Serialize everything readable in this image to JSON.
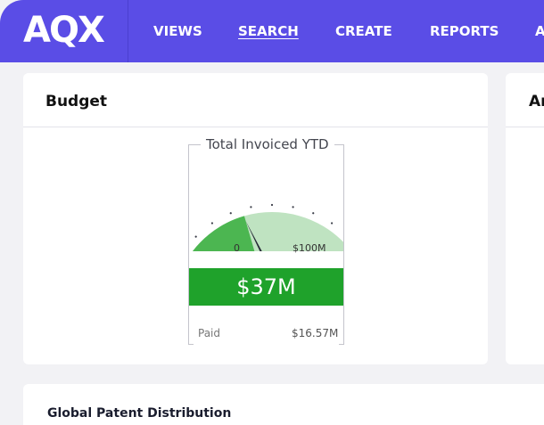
{
  "header": {
    "logo": "AQX",
    "nav": [
      {
        "label": "VIEWS"
      },
      {
        "label": "SEARCH",
        "active": true
      },
      {
        "label": "CREATE"
      },
      {
        "label": "REPORTS"
      },
      {
        "label": "A"
      }
    ]
  },
  "budget": {
    "title": "Budget",
    "gauge": {
      "title": "Total Invoiced YTD",
      "min_label": "0",
      "max_label": "$100M",
      "value_display": "$37M",
      "value_fraction": 0.37,
      "paid_label": "Paid",
      "paid_value": "$16.57M",
      "colors": {
        "filled": "#4cb651",
        "remaining": "#bfe3c1",
        "value_bar": "#1fa22b",
        "needle": "#262a36"
      }
    }
  },
  "right_card": {
    "title": "Ar"
  },
  "global": {
    "title": "Global Patent Distribution"
  },
  "colors": {
    "brand": "#5a4de6",
    "background": "#f2f2f5"
  }
}
